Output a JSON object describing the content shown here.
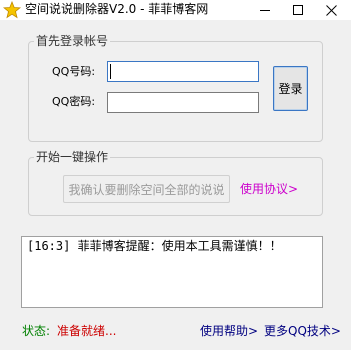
{
  "window": {
    "title": "空间说说删除器V2.0 - 菲菲博客网",
    "icon": "star-icon"
  },
  "login": {
    "group_title": "首先登录帐号",
    "qq_label": "QQ号码:",
    "pwd_label": "QQ密码:",
    "qq_value": "",
    "pwd_value": "",
    "login_button": "登录"
  },
  "ops": {
    "group_title": "开始一键操作",
    "confirm_button": "我确认要删除空间全部的说说",
    "protocol_link": "使用协议>"
  },
  "log": {
    "text": "[16:3] 菲菲博客提醒：使用本工具需谨慎！！"
  },
  "status": {
    "label": "状态:",
    "value": "准备就绪...",
    "help_link": "使用帮助>",
    "more_link": "更多QQ技术>"
  },
  "colors": {
    "status_label": "#008000",
    "status_value": "#cc0000",
    "links": "#000080",
    "protocol_link": "#cc00cc",
    "focus_border": "#3a76c4"
  }
}
